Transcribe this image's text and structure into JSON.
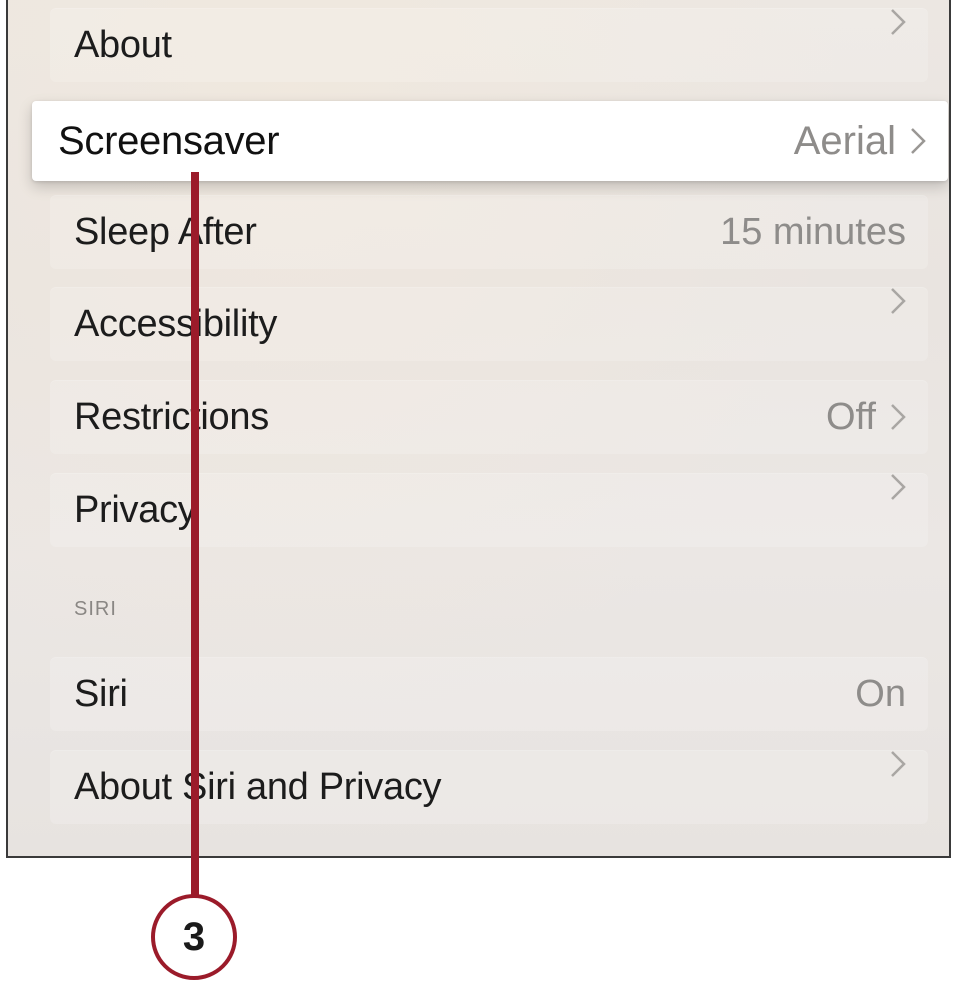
{
  "settings": {
    "rows": [
      {
        "label": "About",
        "value": "",
        "chevron": true
      },
      {
        "label": "Screensaver",
        "value": "Aerial",
        "chevron": true,
        "focused": true
      },
      {
        "label": "Sleep After",
        "value": "15 minutes",
        "chevron": false
      },
      {
        "label": "Accessibility",
        "value": "",
        "chevron": true
      },
      {
        "label": "Restrictions",
        "value": "Off",
        "chevron": true
      },
      {
        "label": "Privacy",
        "value": "",
        "chevron": true
      }
    ],
    "siri_section": {
      "header": "SIRI",
      "rows": [
        {
          "label": "Siri",
          "value": "On",
          "chevron": false
        },
        {
          "label": "About Siri and Privacy",
          "value": "",
          "chevron": true
        }
      ]
    }
  },
  "callout": {
    "number": "3",
    "color": "#9b1b2a"
  },
  "icons": {
    "chevron": "chevron-right-icon"
  }
}
